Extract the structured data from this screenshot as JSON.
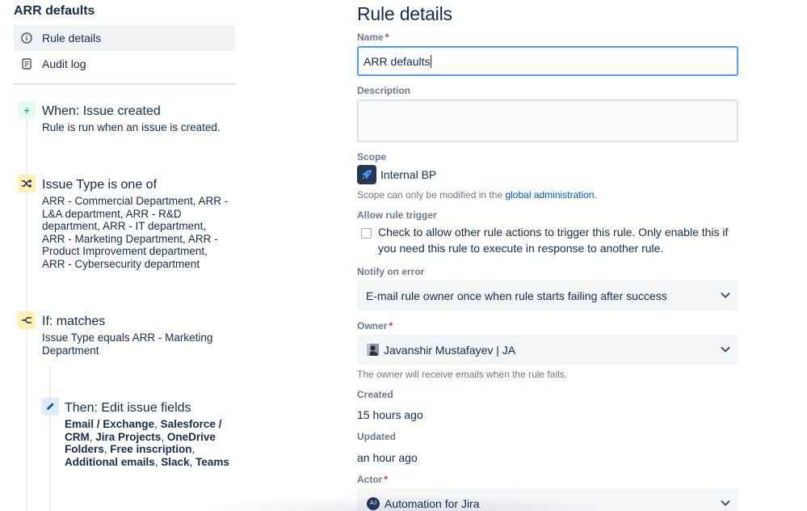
{
  "left": {
    "rule_title": "ARR defaults",
    "nav": [
      {
        "label": "Rule details",
        "icon": "info-icon",
        "active": true
      },
      {
        "label": "Audit log",
        "icon": "document-icon",
        "active": false
      }
    ],
    "components": {
      "trigger": {
        "title": "When: Issue created",
        "desc": "Rule is run when an issue is created.",
        "icon": "plus-icon",
        "color": "#e3fcef"
      },
      "condition1": {
        "title": "Issue Type is one of",
        "lines": [
          "ARR - Commercial Department, ARR -",
          "L&A department, ARR - R&D",
          "department, ARR - IT department,",
          "ARR - Marketing Department, ARR -",
          "Product Improvement department,",
          "ARR - Cybersecurity department"
        ],
        "icon": "shuffle-icon",
        "color": "#fff0b3"
      },
      "condition2": {
        "title": "If: matches",
        "lines": [
          "Issue Type equals ARR - Marketing",
          "Department"
        ],
        "icon": "branch-icon",
        "color": "#fff0b3"
      },
      "action": {
        "title": "Then: Edit issue fields",
        "icon": "pencil-icon",
        "color": "#deebff",
        "fields": [
          {
            "text": "Email / Exchange",
            "sep": ", "
          },
          {
            "text": "Salesforce /",
            "sep": ""
          },
          {
            "text": "CRM",
            "sep": ", "
          },
          {
            "text": "Jira Projects",
            "sep": ", "
          },
          {
            "text": "OneDrive",
            "sep": ""
          },
          {
            "text": "Folders",
            "sep": ", "
          },
          {
            "text": "Free inscription",
            "sep": ","
          },
          {
            "text": "Additional emails",
            "sep": ", "
          },
          {
            "text": "Slack",
            "sep": ", "
          },
          {
            "text": "Teams",
            "sep": ""
          }
        ]
      }
    }
  },
  "right": {
    "page_title": "Rule details",
    "name": {
      "label": "Name",
      "required": "*",
      "value": "ARR defaults"
    },
    "description": {
      "label": "Description",
      "value": ""
    },
    "scope": {
      "label": "Scope",
      "value": "Internal BP",
      "help_prefix": "Scope can only be modified in the ",
      "help_link": "global administration",
      "help_suffix": "."
    },
    "allow_trigger": {
      "label": "Allow rule trigger",
      "text": "Check to allow other rule actions to trigger this rule. Only enable this if you need this rule to execute in response to another rule."
    },
    "notify": {
      "label": "Notify on error",
      "value": "E-mail rule owner once when rule starts failing after success"
    },
    "owner": {
      "label": "Owner",
      "required": "*",
      "value": "Javanshir Mustafayev | JA",
      "help": "The owner will receive emails when the rule fails."
    },
    "created": {
      "label": "Created",
      "value": "15 hours ago"
    },
    "updated": {
      "label": "Updated",
      "value": "an hour ago"
    },
    "actor": {
      "label": "Actor",
      "required": "*",
      "value": "Automation for Jira",
      "avatar_initials": "AJ"
    }
  },
  "colors": {
    "accent": "#0052cc",
    "focus": "#4c9aff",
    "required": "#de350b",
    "muted": "#6b778c"
  }
}
